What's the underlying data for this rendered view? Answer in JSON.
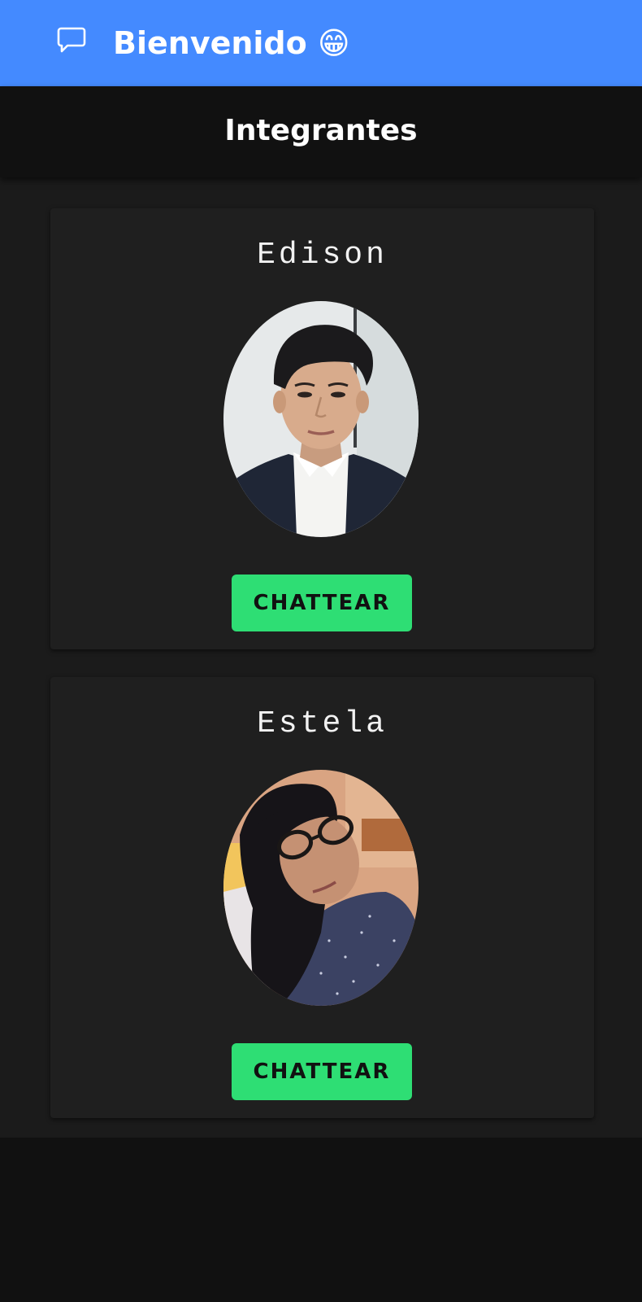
{
  "app_bar": {
    "title": "Bienvenido 😁",
    "icon": "chat-bubble-icon",
    "color": "#448aff"
  },
  "header": {
    "title": "Integrantes"
  },
  "members": [
    {
      "name": "Edison",
      "photo": "person-photo-edison",
      "button_label": "CHATTEAR"
    },
    {
      "name": "Estela",
      "photo": "person-photo-estela",
      "button_label": "CHATTEAR"
    }
  ],
  "colors": {
    "accent_button": "#2ede74",
    "background": "#111111",
    "card": "#1f1f1f"
  }
}
